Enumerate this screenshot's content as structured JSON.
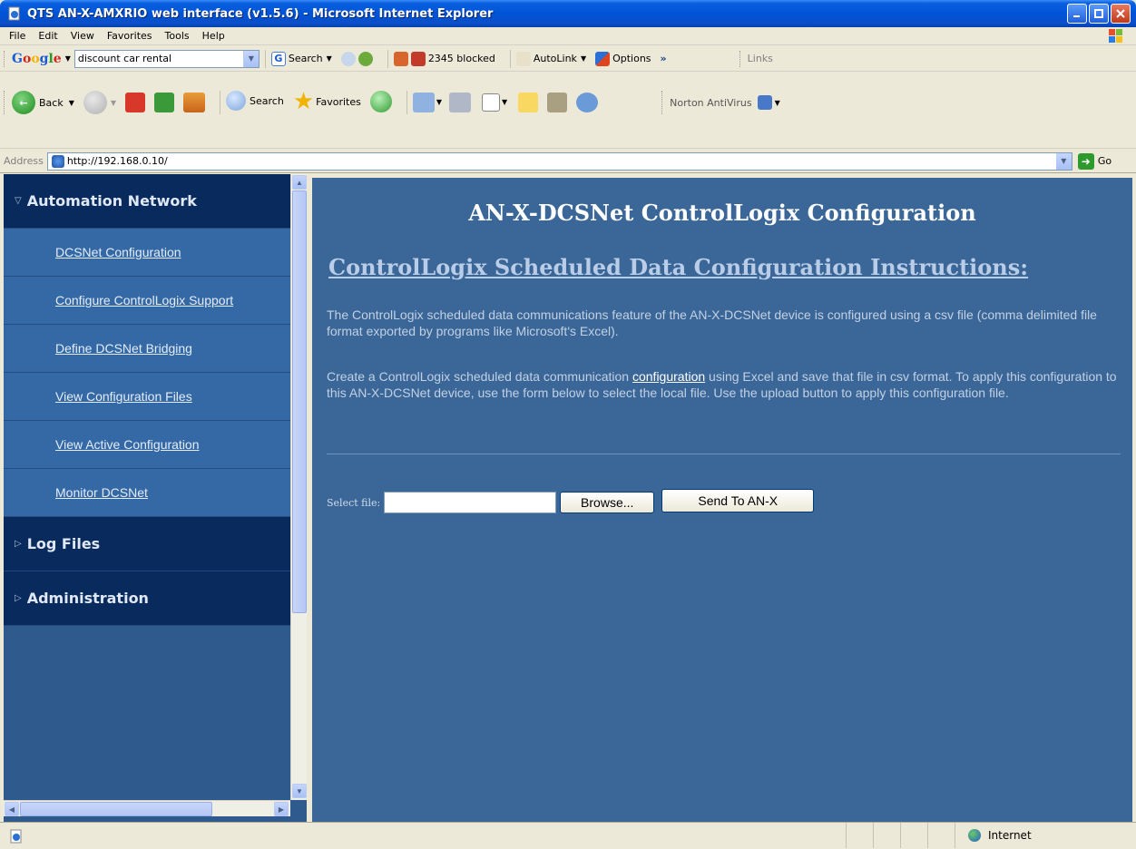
{
  "window": {
    "title": "QTS AN-X-AMXRIO web interface (v1.5.6) - Microsoft Internet Explorer"
  },
  "menubar": {
    "items": [
      "File",
      "Edit",
      "View",
      "Favorites",
      "Tools",
      "Help"
    ]
  },
  "google_toolbar": {
    "search_value": "discount car rental",
    "search_label": "Search",
    "blocked_label": "2345 blocked",
    "autolink_label": "AutoLink",
    "options_label": "Options",
    "more_label": "»",
    "links_label": "Links"
  },
  "standard_toolbar": {
    "back_label": "Back",
    "search_label": "Search",
    "favorites_label": "Favorites",
    "norton_label": "Norton AntiVirus"
  },
  "addressbar": {
    "label": "Address",
    "url": "http://192.168.0.10/",
    "go_label": "Go"
  },
  "sidebar": {
    "sections": [
      {
        "title": "Automation Network",
        "expanded": true,
        "items": [
          "DCSNet Configuration",
          "Configure ControlLogix Support",
          "Define DCSNet Bridging",
          "View Configuration Files",
          "View Active Configuration",
          "Monitor DCSNet"
        ]
      },
      {
        "title": "Log Files",
        "expanded": false
      },
      {
        "title": "Administration",
        "expanded": false
      }
    ]
  },
  "main": {
    "page_title": "AN-X-DCSNet ControlLogix Configuration",
    "section_heading": "ControlLogix Scheduled Data Configuration Instructions:",
    "para1": "The ControlLogix scheduled data communications feature of the AN-X-DCSNet device is configured using a csv file (comma delimited file format exported by programs like Microsoft's Excel).",
    "para2_before": "Create a ControlLogix scheduled data communication ",
    "para2_link": "configuration",
    "para2_after": " using Excel and save that file in csv format. To apply this configuration to this AN-X-DCSNet device, use the form below to select the local file. Use the upload button to apply this configuration file.",
    "select_file_label": "Select file:",
    "browse_label": "Browse...",
    "send_label": "Send To AN-X"
  },
  "statusbar": {
    "zone": "Internet"
  },
  "colors": {
    "nav_section_bg": "#092a5c",
    "nav_item_bg": "#3469a6",
    "main_bg": "#3a6797"
  }
}
